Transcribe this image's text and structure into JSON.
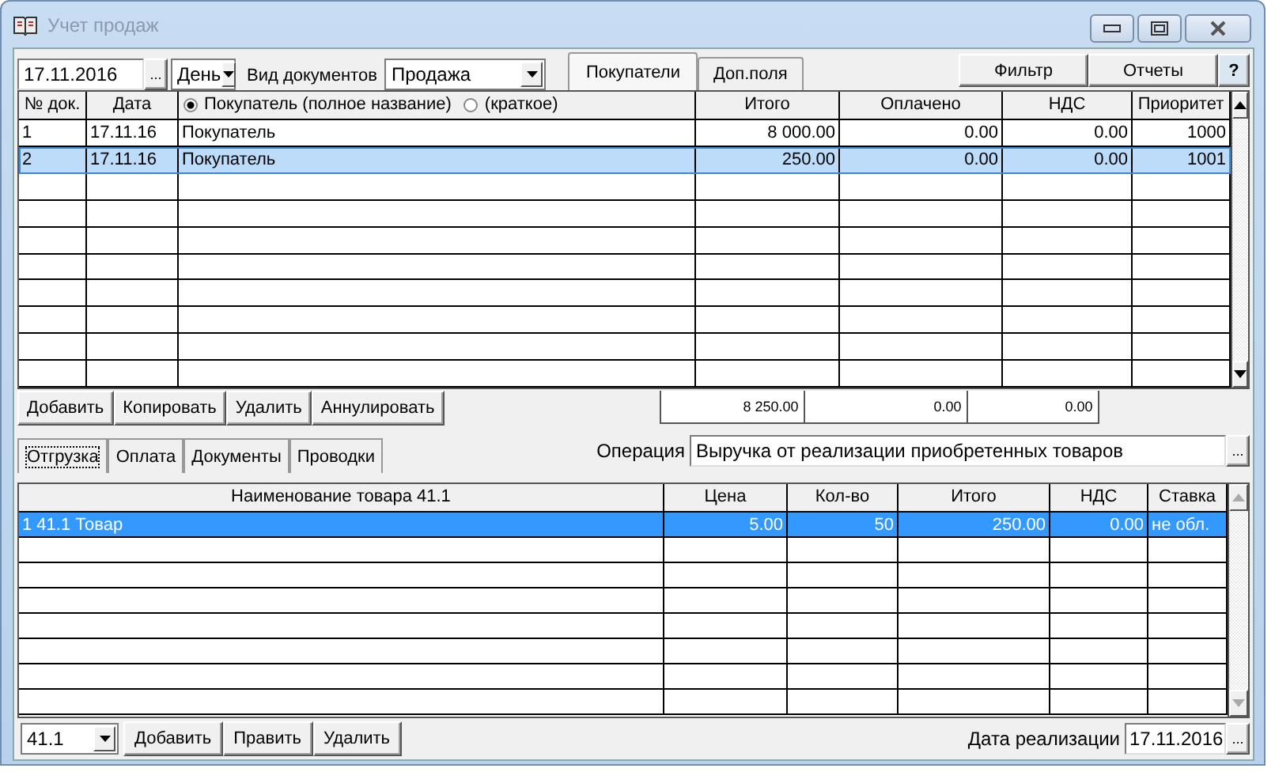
{
  "window": {
    "title": "Учет продаж"
  },
  "toolbar": {
    "date": "17.11.2016",
    "date_button": "...",
    "period": "День",
    "doc_type_label": "Вид документов",
    "doc_type": "Продажа"
  },
  "tabs": [
    {
      "label": "Покупатели",
      "selected": true
    },
    {
      "label": "Доп.поля",
      "selected": false
    }
  ],
  "top_buttons": [
    "Фильтр",
    "Отчеты",
    "?"
  ],
  "documents": {
    "columns": [
      {
        "label": "№ док."
      },
      {
        "label": "Дата"
      },
      {
        "options": [
          {
            "label": "Покупатель (полное название)",
            "selected": true
          },
          {
            "label": "(краткое)",
            "selected": false
          }
        ]
      },
      {
        "label": "Итого"
      },
      {
        "label": "Оплачено"
      },
      {
        "label": "НДС"
      },
      {
        "label": "Приоритет"
      }
    ],
    "rows": [
      {
        "cells": [
          "1",
          "17.11.16",
          "Покупатель",
          "8 000.00",
          "0.00",
          "0.00",
          "1000"
        ],
        "selected": false
      },
      {
        "cells": [
          "2",
          "17.11.16",
          "Покупатель",
          "250.00",
          "0.00",
          "0.00",
          "1001"
        ],
        "selected": true
      }
    ],
    "totals": [
      "8 250.00",
      "0.00",
      "0.00"
    ]
  },
  "actions": [
    "Добавить",
    "Копировать",
    "Удалить",
    "Аннулировать"
  ],
  "lower_tabs": [
    {
      "label": "Отгрузка",
      "selected": true
    },
    {
      "label": "Оплата",
      "selected": false
    },
    {
      "label": "Документы",
      "selected": false
    },
    {
      "label": "Проводки",
      "selected": false
    }
  ],
  "operation": {
    "label": "Операция",
    "value": "Выручка от реализации приобретенных товаров",
    "button": "..."
  },
  "goods": {
    "columns": [
      {
        "label": "Наименование товара 41.1"
      },
      {
        "label": "Цена"
      },
      {
        "label": "Кол-во"
      },
      {
        "label": "Итого"
      },
      {
        "label": "НДС"
      },
      {
        "label": "Ставка"
      }
    ],
    "rows": [
      {
        "cells": [
          "1 41.1 Товар",
          "5.00",
          "50",
          "250.00",
          "0.00",
          "не обл."
        ],
        "selected": true
      }
    ]
  },
  "footer": {
    "account": "41.1",
    "buttons": [
      "Добавить",
      "Править",
      "Удалить"
    ],
    "date_label": "Дата реализации",
    "date": "17.11.2016",
    "date_button": "..."
  }
}
